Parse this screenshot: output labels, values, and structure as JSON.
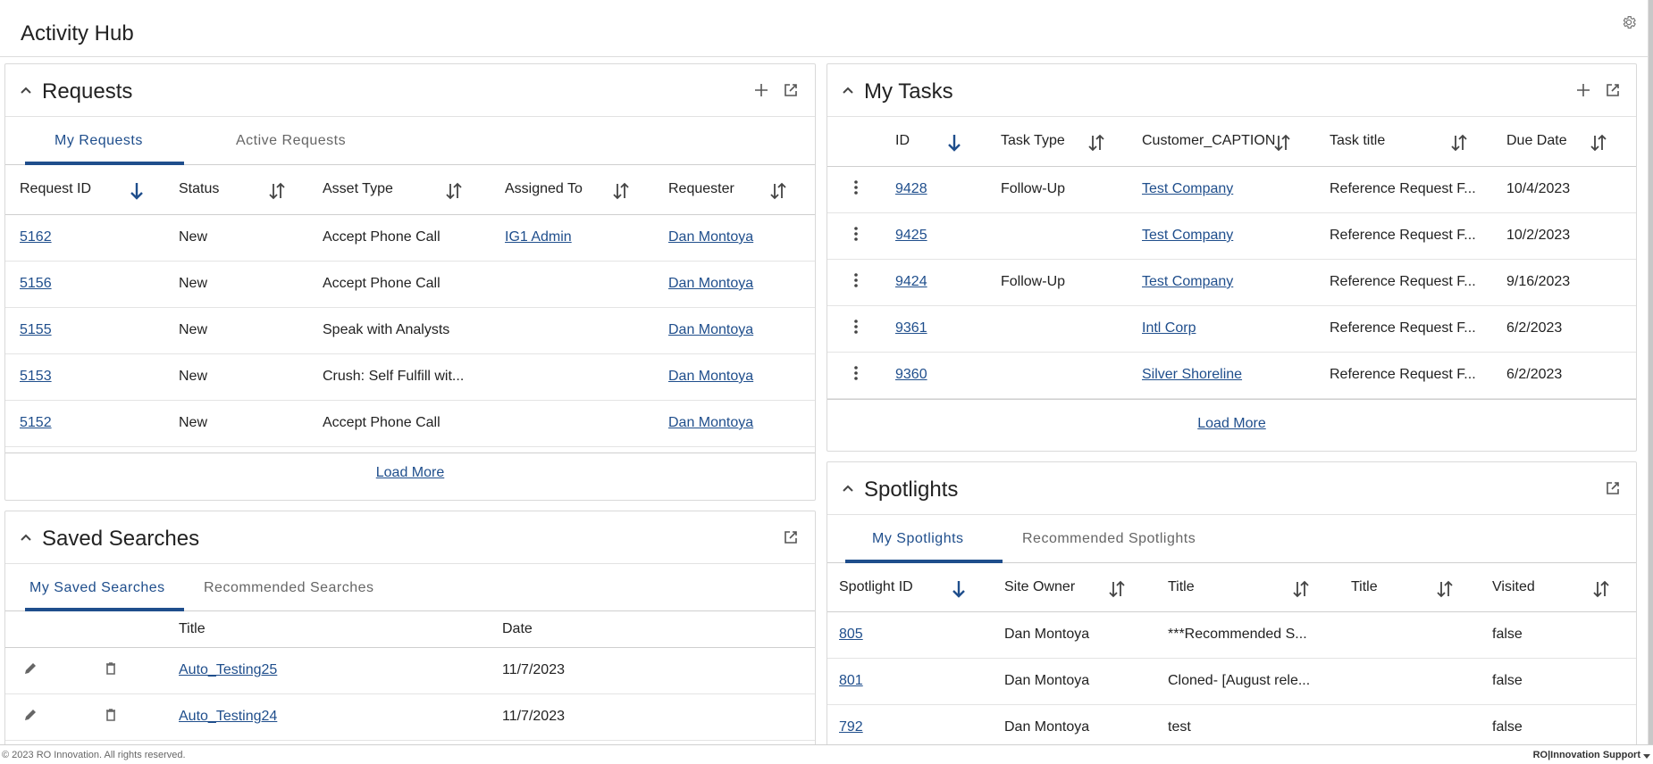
{
  "app": {
    "title": "Activity Hub"
  },
  "requests": {
    "title": "Requests",
    "tabs": [
      {
        "label": "My Requests",
        "active": true
      },
      {
        "label": "Active Requests",
        "active": false
      }
    ],
    "columns": [
      "Request ID",
      "Status",
      "Asset Type",
      "Assigned To",
      "Requester"
    ],
    "rows": [
      {
        "id": "5162",
        "status": "New",
        "asset_type": "Accept Phone Call",
        "assigned_to": "IG1 Admin",
        "requester": "Dan Montoya"
      },
      {
        "id": "5156",
        "status": "New",
        "asset_type": "Accept Phone Call",
        "assigned_to": "",
        "requester": "Dan Montoya"
      },
      {
        "id": "5155",
        "status": "New",
        "asset_type": "Speak with Analysts",
        "assigned_to": "",
        "requester": "Dan Montoya"
      },
      {
        "id": "5153",
        "status": "New",
        "asset_type": "Crush: Self Fulfill wit...",
        "assigned_to": "",
        "requester": "Dan Montoya"
      },
      {
        "id": "5152",
        "status": "New",
        "asset_type": "Accept Phone Call",
        "assigned_to": "",
        "requester": "Dan Montoya"
      }
    ],
    "load_more": "Load More"
  },
  "tasks": {
    "title": "My Tasks",
    "columns": [
      "ID",
      "Task Type",
      "Customer_CAPTION",
      "Task title",
      "Due Date"
    ],
    "rows": [
      {
        "id": "9428",
        "task_type": "Follow-Up",
        "customer": "Test Company",
        "task_title": "Reference Request F...",
        "due_date": "10/4/2023"
      },
      {
        "id": "9425",
        "task_type": "",
        "customer": "Test Company",
        "task_title": "Reference Request F...",
        "due_date": "10/2/2023"
      },
      {
        "id": "9424",
        "task_type": "Follow-Up",
        "customer": "Test Company",
        "task_title": "Reference Request F...",
        "due_date": "9/16/2023"
      },
      {
        "id": "9361",
        "task_type": "",
        "customer": "Intl Corp",
        "task_title": "Reference Request F...",
        "due_date": "6/2/2023"
      },
      {
        "id": "9360",
        "task_type": "",
        "customer": "Silver Shoreline",
        "task_title": "Reference Request F...",
        "due_date": "6/2/2023"
      }
    ],
    "load_more": "Load More"
  },
  "saved_searches": {
    "title": "Saved Searches",
    "tabs": [
      {
        "label": "My Saved Searches",
        "active": true
      },
      {
        "label": "Recommended Searches",
        "active": false
      }
    ],
    "columns": [
      "Title",
      "Date"
    ],
    "rows": [
      {
        "title": "Auto_Testing25",
        "date": "11/7/2023"
      },
      {
        "title": "Auto_Testing24",
        "date": "11/7/2023"
      }
    ]
  },
  "spotlights": {
    "title": "Spotlights",
    "tabs": [
      {
        "label": "My Spotlights",
        "active": true
      },
      {
        "label": "Recommended Spotlights",
        "active": false
      }
    ],
    "columns": [
      "Spotlight ID",
      "Site Owner",
      "Title",
      "Title",
      "Visited"
    ],
    "rows": [
      {
        "id": "805",
        "owner": "Dan Montoya",
        "title": "***Recommended S...",
        "title2": "",
        "visited": "false"
      },
      {
        "id": "801",
        "owner": "Dan Montoya",
        "title": "Cloned- [August rele...",
        "title2": "",
        "visited": "false"
      },
      {
        "id": "792",
        "owner": "Dan Montoya",
        "title": "test",
        "title2": "",
        "visited": "false"
      }
    ]
  },
  "footer": {
    "copyright": "© 2023 RO Innovation. All rights reserved.",
    "brand": "RO|Innovation Support"
  },
  "colors": {
    "accent": "#1f4e8c",
    "border": "#d9d9d9"
  },
  "icons": {
    "settings": "gear-icon",
    "collapse": "chevron-up-icon",
    "add": "plus-icon",
    "open": "external-link-icon",
    "sort_active": "arrow-down-icon",
    "sort": "sort-arrows-icon",
    "row_menu": "kebab-menu-icon",
    "edit": "pencil-icon",
    "delete": "trash-icon"
  }
}
